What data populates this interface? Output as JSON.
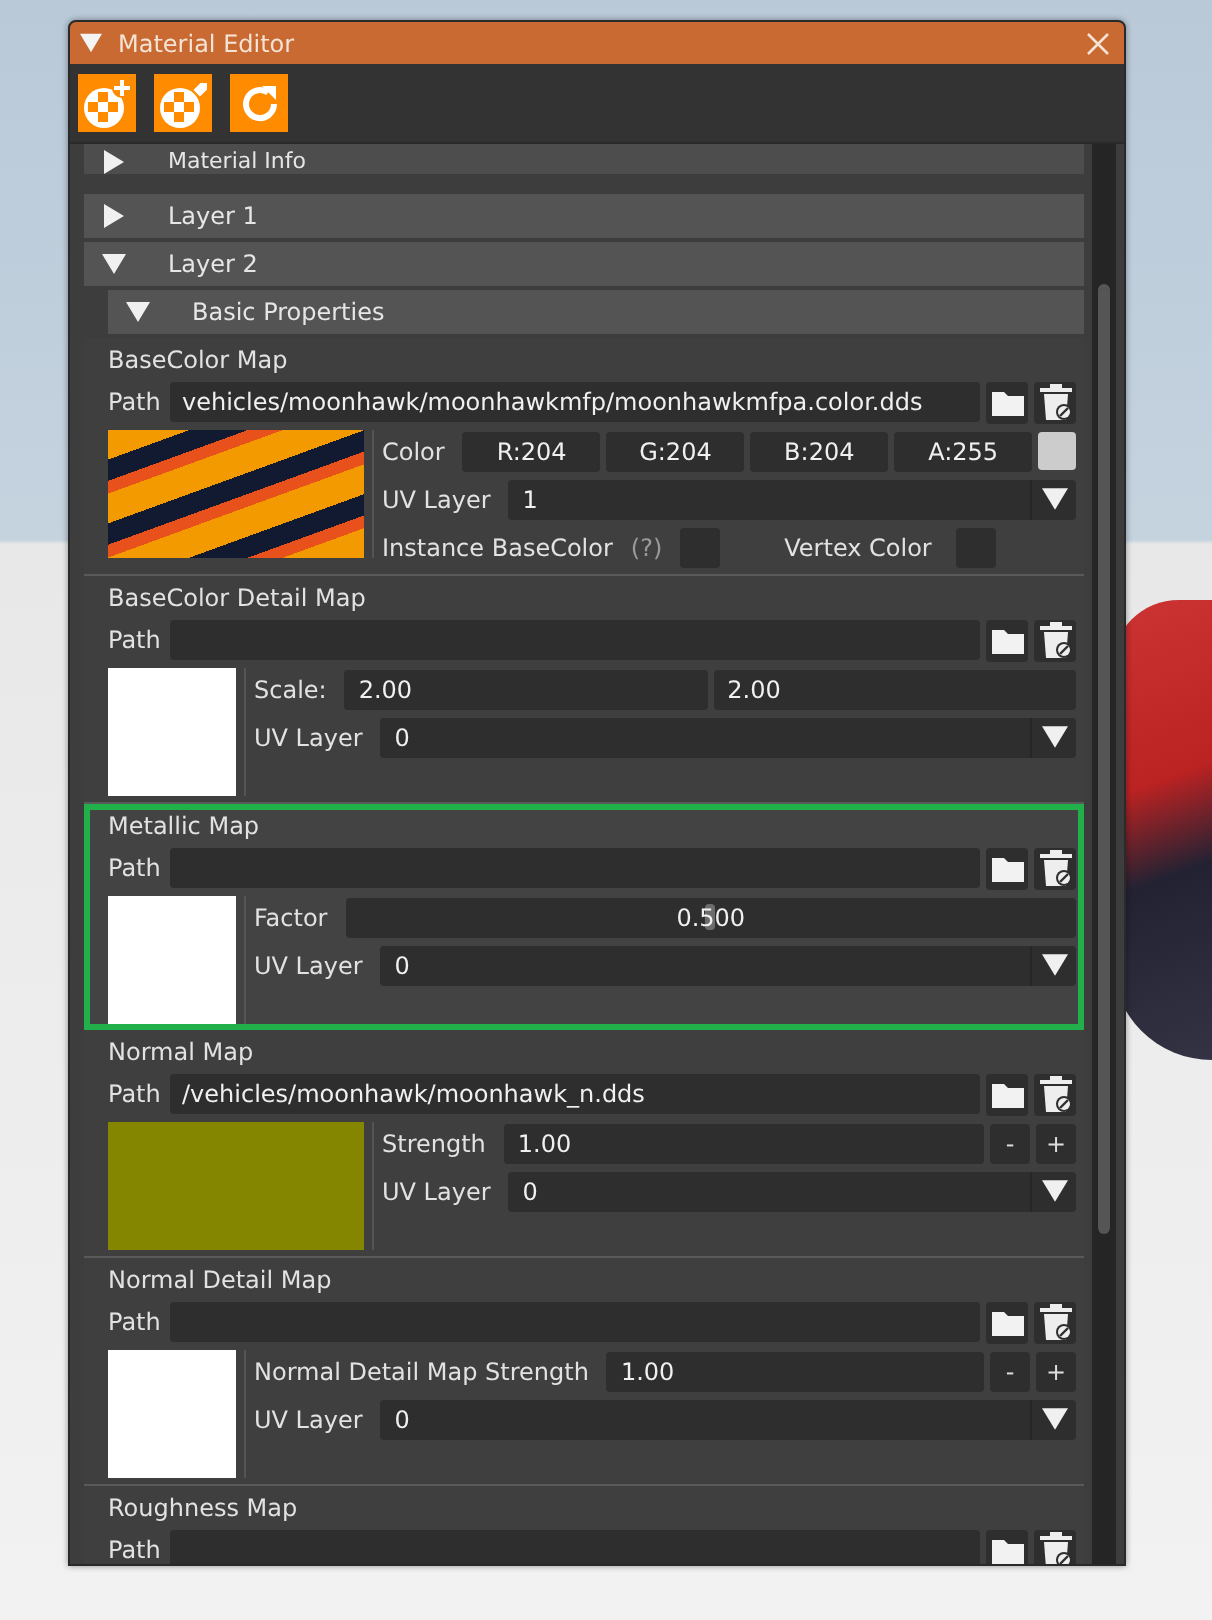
{
  "window": {
    "title": "Material Editor",
    "expanded": true
  },
  "toolbar": [
    {
      "kind": "add"
    },
    {
      "kind": "tag"
    },
    {
      "kind": "reload"
    }
  ],
  "sections": [
    {
      "label": "Material Info",
      "expanded": false
    },
    {
      "label": "Layer 1",
      "expanded": false
    },
    {
      "label": "Layer 2",
      "expanded": true,
      "children": [
        {
          "label": "Basic Properties",
          "expanded": true
        }
      ]
    }
  ],
  "maps": [
    {
      "title": "BaseColor Map",
      "path_label": "Path",
      "path": "vehicles/moonhawk/moonhawkmfp/moonhawkmfpa.color.dds",
      "kind": "texture",
      "highlighted": false,
      "rows": [
        {
          "kind": "color",
          "label": "Color",
          "channels": [
            "R:204",
            "G:204",
            "B:204",
            "A:255"
          ],
          "color": "#cccccc"
        },
        {
          "kind": "dropdown",
          "label": "UV Layer",
          "value": "1"
        },
        {
          "kind": "checks",
          "items": [
            {
              "label": "Instance BaseColor",
              "hint": "(?)",
              "checked": false
            },
            {
              "label": "Vertex Color",
              "checked": false
            }
          ]
        }
      ]
    },
    {
      "title": "BaseColor Detail Map",
      "path_label": "Path",
      "kind": "blank",
      "highlighted": false,
      "rows": [
        {
          "kind": "pair",
          "label": "Scale:",
          "values": [
            "2.00",
            "2.00"
          ]
        },
        {
          "kind": "dropdown",
          "label": "UV Layer",
          "value": "0"
        }
      ]
    },
    {
      "title": "Metallic Map",
      "path_label": "Path",
      "kind": "blank",
      "highlighted": true,
      "rows": [
        {
          "kind": "slider",
          "label": "Factor",
          "value": "0.500",
          "level": 0.5
        },
        {
          "kind": "dropdown",
          "label": "UV Layer",
          "value": "0"
        }
      ]
    },
    {
      "title": "Normal Map",
      "path_label": "Path",
      "path": "/vehicles/moonhawk/moonhawk_n.dds",
      "kind": "normal",
      "highlighted": false,
      "rows": [
        {
          "kind": "stepper",
          "label": "Strength",
          "value": "1.00",
          "minus": "-",
          "plus": "+"
        },
        {
          "kind": "dropdown",
          "label": "UV Layer",
          "value": "0"
        }
      ]
    },
    {
      "title": "Normal Detail Map",
      "path_label": "Path",
      "kind": "blank",
      "highlighted": false,
      "rows": [
        {
          "kind": "stepper",
          "label": "Normal Detail Map Strength",
          "value": "1.00",
          "minus": "-",
          "plus": "+"
        },
        {
          "kind": "dropdown",
          "label": "UV Layer",
          "value": "0"
        }
      ]
    },
    {
      "title": "Roughness Map",
      "path_label": "Path",
      "kind": "none",
      "highlighted": false
    }
  ]
}
